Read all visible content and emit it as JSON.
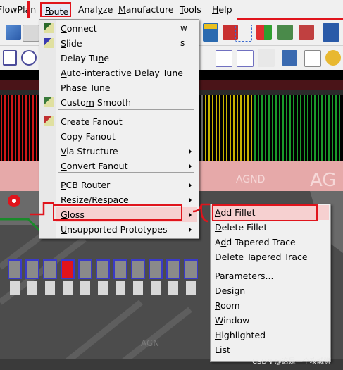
{
  "menubar": {
    "items": [
      {
        "pre": "Flow",
        "ul": "",
        "post": "Plan"
      },
      {
        "pre": "",
        "ul": "R",
        "post": "oute"
      },
      {
        "pre": "Anal",
        "ul": "y",
        "post": "ze"
      },
      {
        "pre": "",
        "ul": "M",
        "post": "anufacture"
      },
      {
        "pre": "",
        "ul": "T",
        "post": "ools"
      },
      {
        "pre": "",
        "ul": "H",
        "post": "elp"
      }
    ]
  },
  "route_menu": {
    "items": [
      {
        "pre": "",
        "ul": "C",
        "post": "onnect",
        "shortcut": "w",
        "icon": "connect-icon"
      },
      {
        "pre": "",
        "ul": "S",
        "post": "lide",
        "shortcut": "s",
        "icon": "slide-icon"
      },
      {
        "pre": "Delay Tu",
        "ul": "n",
        "post": "e",
        "shortcut": "",
        "icon": ""
      },
      {
        "pre": "",
        "ul": "A",
        "post": "uto-interactive Delay Tune",
        "shortcut": "",
        "icon": ""
      },
      {
        "pre": "P",
        "ul": "h",
        "post": "ase Tune",
        "shortcut": "",
        "icon": ""
      },
      {
        "pre": "Custo",
        "ul": "m",
        "post": " Smooth",
        "shortcut": "",
        "icon": "smooth-icon"
      },
      {
        "pre": "Create Fanout",
        "ul": "",
        "post": "",
        "shortcut": "",
        "icon": "fanout-icon"
      },
      {
        "pre": "Copy Fanout",
        "ul": "",
        "post": "",
        "shortcut": "",
        "icon": ""
      },
      {
        "pre": "",
        "ul": "V",
        "post": "ia Structure",
        "shortcut": "",
        "icon": ""
      },
      {
        "pre": "",
        "ul": "C",
        "post": "onvert Fanout",
        "shortcut": "",
        "icon": ""
      },
      {
        "pre": "",
        "ul": "P",
        "post": "CB Router",
        "shortcut": "",
        "icon": ""
      },
      {
        "pre": "Resize/Respace",
        "ul": "",
        "post": "",
        "shortcut": "",
        "icon": ""
      },
      {
        "pre": "",
        "ul": "G",
        "post": "loss",
        "shortcut": "",
        "icon": ""
      },
      {
        "pre": "",
        "ul": "U",
        "post": "nsupported Prototypes",
        "shortcut": "",
        "icon": ""
      }
    ]
  },
  "gloss_menu": {
    "items": [
      {
        "pre": "",
        "ul": "A",
        "post": "dd Fillet"
      },
      {
        "pre": "",
        "ul": "D",
        "post": "elete Fillet"
      },
      {
        "pre": "A",
        "ul": "d",
        "post": "d Tapered Trace"
      },
      {
        "pre": "D",
        "ul": "e",
        "post": "lete Tapered Trace"
      },
      {
        "pre": "",
        "ul": "P",
        "post": "arameters..."
      },
      {
        "pre": "",
        "ul": "D",
        "post": "esign"
      },
      {
        "pre": "",
        "ul": "R",
        "post": "oom"
      },
      {
        "pre": "",
        "ul": "W",
        "post": "indow"
      },
      {
        "pre": "",
        "ul": "H",
        "post": "ighlighted"
      },
      {
        "pre": "",
        "ul": "L",
        "post": "ist"
      }
    ]
  },
  "canvas": {
    "labels": [
      "AGND",
      "AG",
      "AGN"
    ]
  },
  "watermark": "CSDN @这是一个攻城狮",
  "colors": {
    "highlight_red": "#e0141c",
    "menu_bg": "#f0f0f0",
    "pcb_bg": "#000000",
    "trace_green": "#1a8a2a",
    "pad_gray": "#6a6a6a",
    "copper_red": "#c0282e",
    "yellow": "#d8c800"
  }
}
